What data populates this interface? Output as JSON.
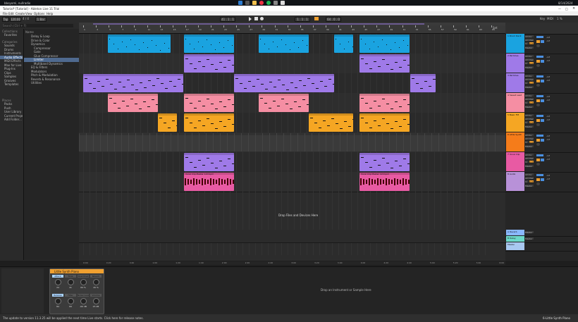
{
  "taskbar": {
    "user": "bboyomi, nullradio",
    "date": "8/14/2024"
  },
  "window": {
    "title": "Tutorial* [Tutorial] - Ableton Live 11 Trial"
  },
  "menu": [
    "File",
    "Edit",
    "Create",
    "View",
    "Options",
    "Help"
  ],
  "transport": {
    "tap": "Tap",
    "tempo": "120.00",
    "sig": "4 / 4",
    "metro": "1 Bar",
    "position": "41 . 1 . 1",
    "loop_start": "1 . 1 . 1",
    "loop_len": "64 . 0 . 0",
    "key": "Key",
    "midi": "MIDI",
    "cpu": "1 %"
  },
  "browser": {
    "search_placeholder": "Search (Ctrl + F)",
    "collections_label": "Collections",
    "favorites": "Favorites",
    "categories_label": "Categories",
    "categories": [
      "Sounds",
      "Drums",
      "Instruments",
      "Audio Effects",
      "MIDI Effects",
      "Max for Live",
      "Plug-Ins",
      "Clips",
      "Samples",
      "Grooves",
      "Templates"
    ],
    "places_label": "Places",
    "places": [
      "Packs",
      "Push",
      "User Library",
      "Current Project",
      "Add Folder..."
    ],
    "name_header": "Name",
    "items": [
      "Delay & Loop",
      "Drive & Color",
      "Dynamics",
      "Compressor",
      "Gate",
      "Glue Compressor",
      "Limiter",
      "Multiband Dynamics",
      "EQ & Filters",
      "Modulators",
      "Pitch & Modulation",
      "Reverb & Resonance",
      "Utilities"
    ]
  },
  "ruler": {
    "bars": [
      "1",
      "3",
      "5",
      "7",
      "9",
      "11",
      "13",
      "15",
      "17",
      "19",
      "21",
      "23",
      "25",
      "27",
      "29",
      "31",
      "33",
      "35",
      "37",
      "39",
      "41",
      "43",
      "45",
      "47",
      "49",
      "51",
      "53",
      "55",
      "57",
      "59",
      "61",
      "63",
      "65"
    ],
    "set": "Set"
  },
  "timeline": {
    "labels": [
      "0:00",
      "0:20",
      "0:40",
      "1:00",
      "1:20",
      "1:40",
      "2:00",
      "2:20",
      "2:40",
      "3:00",
      "3:20",
      "3:40",
      "4:00",
      "4:20",
      "4:40",
      "5:00",
      "5:20",
      "5:40",
      "6:00"
    ]
  },
  "drop_text": "Drop Files and Devices Here",
  "clip_labels": {
    "vocal": "Vocal Clip Master 120 bpm"
  },
  "tracks": [
    {
      "name": "1 Drum Rack",
      "color": "#1aa3e0"
    },
    {
      "name": "2 Particles",
      "color": "#9f7ae8"
    },
    {
      "name": "3 Particles",
      "color": "#9f7ae8"
    },
    {
      "name": "4 Sweet Lead",
      "color": "#f58ea3"
    },
    {
      "name": "5 Basic FM",
      "color": "#f5a623"
    },
    {
      "name": "6 Little Synth",
      "color": "#f57c1a"
    },
    {
      "name": "7 Vocal Clip",
      "color": "#e85aa3"
    },
    {
      "name": "8 Audio",
      "color": "#b891d8"
    }
  ],
  "returns": [
    {
      "name": "A Reverb",
      "color": "#8ab8ff"
    },
    {
      "name": "B Delay",
      "color": "#6bd8c8"
    }
  ],
  "master": {
    "name": "Master",
    "color": "#a8c8f0"
  },
  "io": {
    "all_ins": "All Ins",
    "all_channels": "All Channe",
    "in": "In",
    "auto": "Auto",
    "off": "Off",
    "master": "Master",
    "inf": "-inf"
  },
  "device": {
    "name": "Little Synth Piano",
    "macros": [
      "Attack",
      "Tone",
      "Overdrive",
      "Reverb",
      "Release",
      "Filter",
      "Noise Level",
      "Volume"
    ],
    "values": [
      "24",
      "41",
      "64 %",
      "20 %",
      "84",
      "69",
      "-60 dB",
      "23 dB"
    ],
    "drop": "Drop an Instrument or Sample Here",
    "chain_label": "6-Little Synth Piano"
  },
  "status": {
    "message": "The update to version 11.3.25 will be applied the next time Live starts. Click here for release notes."
  }
}
